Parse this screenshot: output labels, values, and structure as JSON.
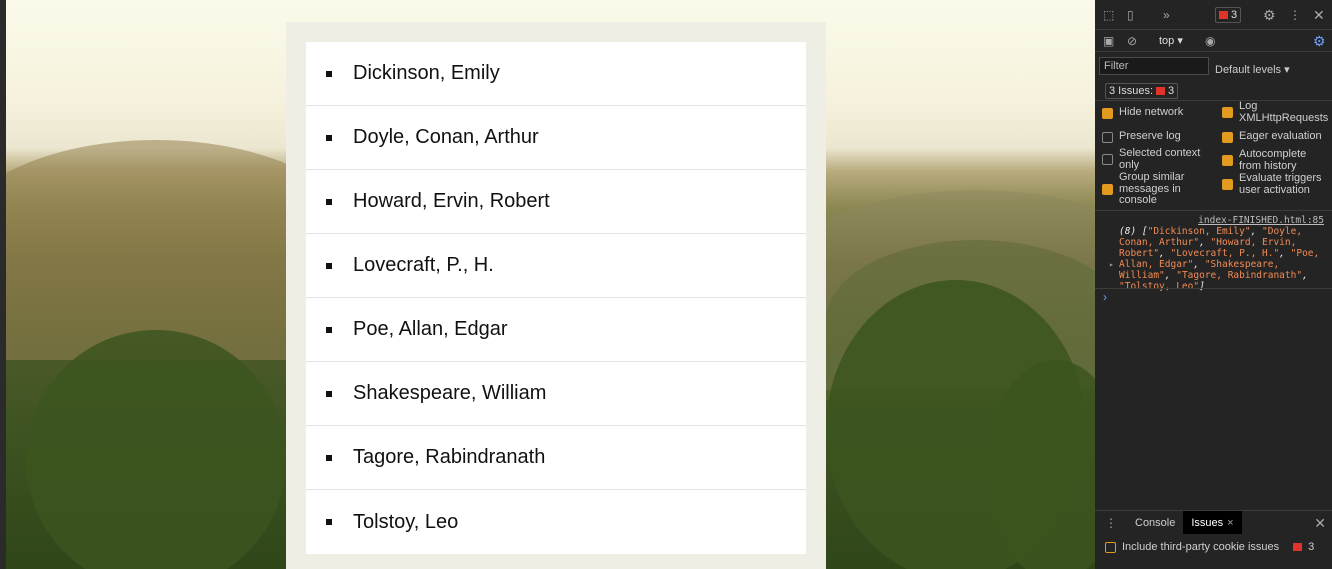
{
  "authors": [
    "Dickinson, Emily",
    "Doyle, Conan, Arthur",
    "Howard, Ervin, Robert",
    "Lovecraft, P., H.",
    "Poe, Allan, Edgar",
    "Shakespeare, William",
    "Tagore, Rabindranath",
    "Tolstoy, Leo"
  ],
  "devtools": {
    "error_count": "3",
    "context": "top",
    "filter_placeholder": "Filter",
    "levels": "Default levels",
    "issues_label": "3 Issues:",
    "issues_count": "3",
    "settings": [
      {
        "label": "Hide network",
        "checked": true
      },
      {
        "label": "Log XMLHttpRequests",
        "checked": true
      },
      {
        "label": "Preserve log",
        "checked": false
      },
      {
        "label": "Eager evaluation",
        "checked": true
      },
      {
        "label": "Selected context only",
        "checked": false
      },
      {
        "label": "Autocomplete from history",
        "checked": true
      },
      {
        "label": "Group similar messages in console",
        "checked": true
      },
      {
        "label": "Evaluate triggers user activation",
        "checked": true
      }
    ],
    "log_source": "index-FINISHED.html:85",
    "log_prefix": "(8) [",
    "log_items": [
      "\"Dickinson, Emily\"",
      "\"Doyle, Conan, Arthur\"",
      "\"Howard, Ervin, Robert\"",
      "\"Lovecraft, P., H.\"",
      "\"Poe, Allan, Edgar\"",
      "\"Shakespeare, William\"",
      "\"Tagore, Rabindranath\"",
      "\"Tolstoy, Leo\""
    ],
    "log_suffix": "]",
    "tabs": [
      "Console",
      "Issues"
    ],
    "third_party": "Include third-party cookie issues",
    "bottom_count": "3"
  }
}
